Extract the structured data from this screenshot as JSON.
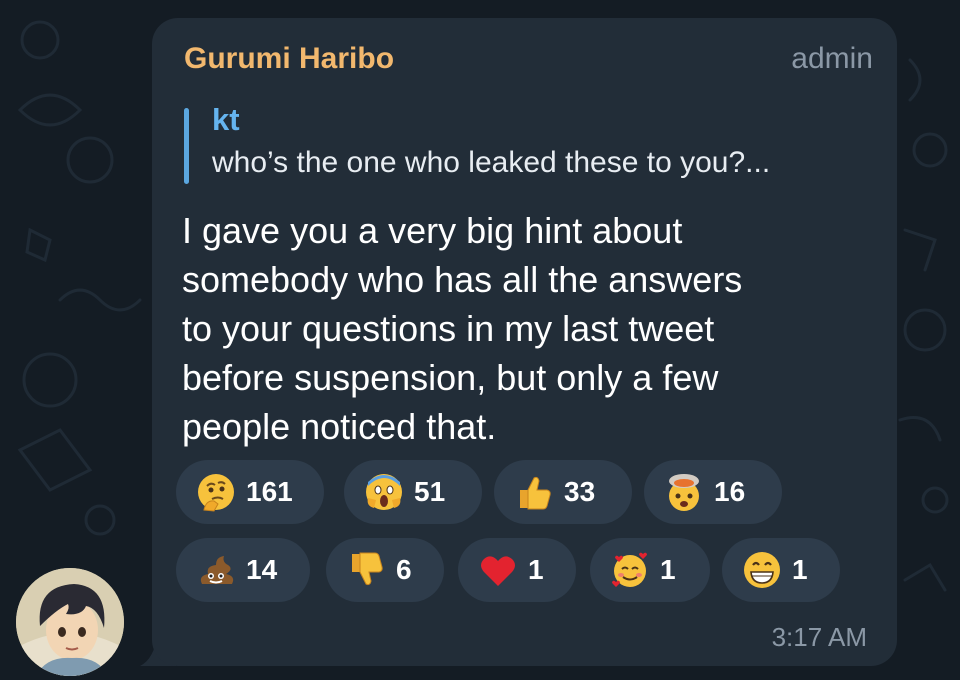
{
  "message": {
    "sender": "Gurumi Haribo",
    "role": "admin",
    "reply": {
      "author": "kt",
      "text": "who’s the one who leaked these to you?..."
    },
    "lines": [
      "I gave you a very big hint about",
      "somebody who has all the answers",
      "to your questions in my last tweet",
      "before suspension, but only a few",
      "people noticed that."
    ],
    "time": "3:17 AM"
  },
  "reactions": [
    {
      "emoji": "thinking-face",
      "count": "161"
    },
    {
      "emoji": "face-screaming-in-fear",
      "count": "51"
    },
    {
      "emoji": "thumbs-up",
      "count": "33"
    },
    {
      "emoji": "exploding-head",
      "count": "16"
    },
    {
      "emoji": "pile-of-poo",
      "count": "14"
    },
    {
      "emoji": "thumbs-down",
      "count": "6"
    },
    {
      "emoji": "red-heart",
      "count": "1"
    },
    {
      "emoji": "smiling-face-with-hearts",
      "count": "1"
    },
    {
      "emoji": "beaming-face",
      "count": "1"
    }
  ],
  "colors": {
    "sender": "#f2b86e",
    "reply_accent": "#5ba7e0",
    "bubble": "#222d38",
    "reaction_pill": "#2e3c4b",
    "background": "#141c24"
  }
}
